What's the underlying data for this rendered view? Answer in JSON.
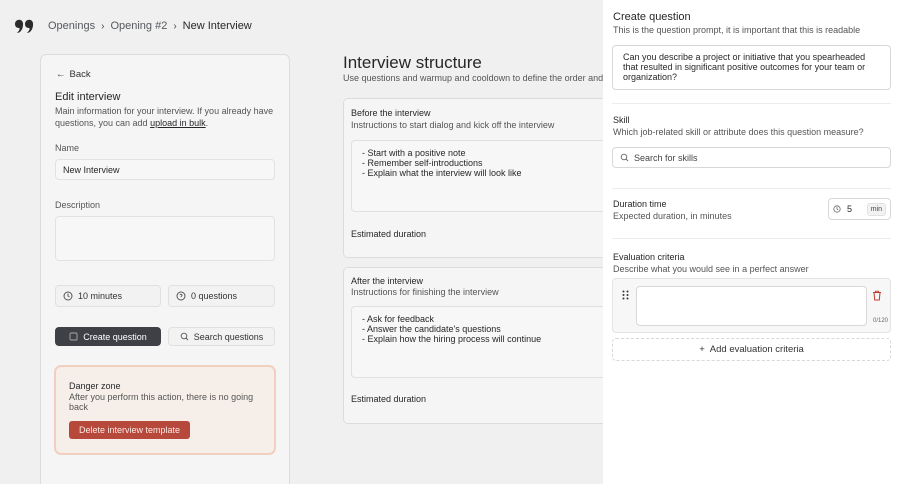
{
  "breadcrumb": {
    "items": [
      "Openings",
      "Opening #2"
    ],
    "current": "New Interview"
  },
  "edit": {
    "back_label": "Back",
    "title": "Edit interview",
    "description": "Main information for your interview. If you already have questions, you can add",
    "upload_link": "upload in bulk",
    "description_end": ".",
    "name_label": "Name",
    "name_value": "New Interview",
    "description_label": "Description",
    "description_value": "",
    "duration_stat": "10 minutes",
    "questions_stat": "0 questions",
    "create_question_label": "Create question",
    "search_questions_label": "Search questions"
  },
  "danger_zone": {
    "title": "Danger zone",
    "text": "After you perform this action, there is no going back",
    "button_label": "Delete interview template"
  },
  "structure": {
    "title": "Interview structure",
    "description": "Use questions and warmup and cooldown to define the order and",
    "sections": [
      {
        "title": "Before the interview",
        "description": "Instructions to start dialog and kick off the interview",
        "lines": [
          "- Start with a positive note",
          "- Remember self-introductions",
          "- Explain what the interview will look like"
        ],
        "estimated_label": "Estimated duration"
      },
      {
        "title": "After the interview",
        "description": "Instructions for finishing the interview",
        "lines": [
          "- Ask for feedback",
          "- Answer the candidate's questions",
          "- Explain how the hiring process will continue"
        ],
        "estimated_label": "Estimated duration"
      }
    ]
  },
  "panel": {
    "title": "Create question",
    "subtitle": "This is the question prompt, it is important that this is readable",
    "prompt_value": "Can you describe a project or initiative that you spearheaded that resulted in significant positive outcomes for your team or organization?",
    "skill_title": "Skill",
    "skill_subtitle": "Which job-related skill or attribute does this question measure?",
    "skill_placeholder": "Search for skills",
    "duration_title": "Duration time",
    "duration_subtitle": "Expected duration, in minutes",
    "duration_value": "5",
    "duration_unit": "min",
    "eval_title": "Evaluation criteria",
    "eval_subtitle": "Describe what you would see in a perfect answer",
    "eval_counter": "0/120",
    "add_criteria_label": "Add evaluation criteria"
  },
  "colors": {
    "danger_button": "#b7483c",
    "dark_button": "#3f3f46",
    "panel_bg": "#ffffff",
    "overlay_bg": "#f0f0f0"
  },
  "icons": [
    "logo-icon",
    "chevron-right-icon",
    "arrow-left-icon",
    "clock-icon",
    "question-circle-icon",
    "edit-icon",
    "search-icon",
    "drag-handle-icon",
    "trash-icon",
    "plus-icon"
  ]
}
